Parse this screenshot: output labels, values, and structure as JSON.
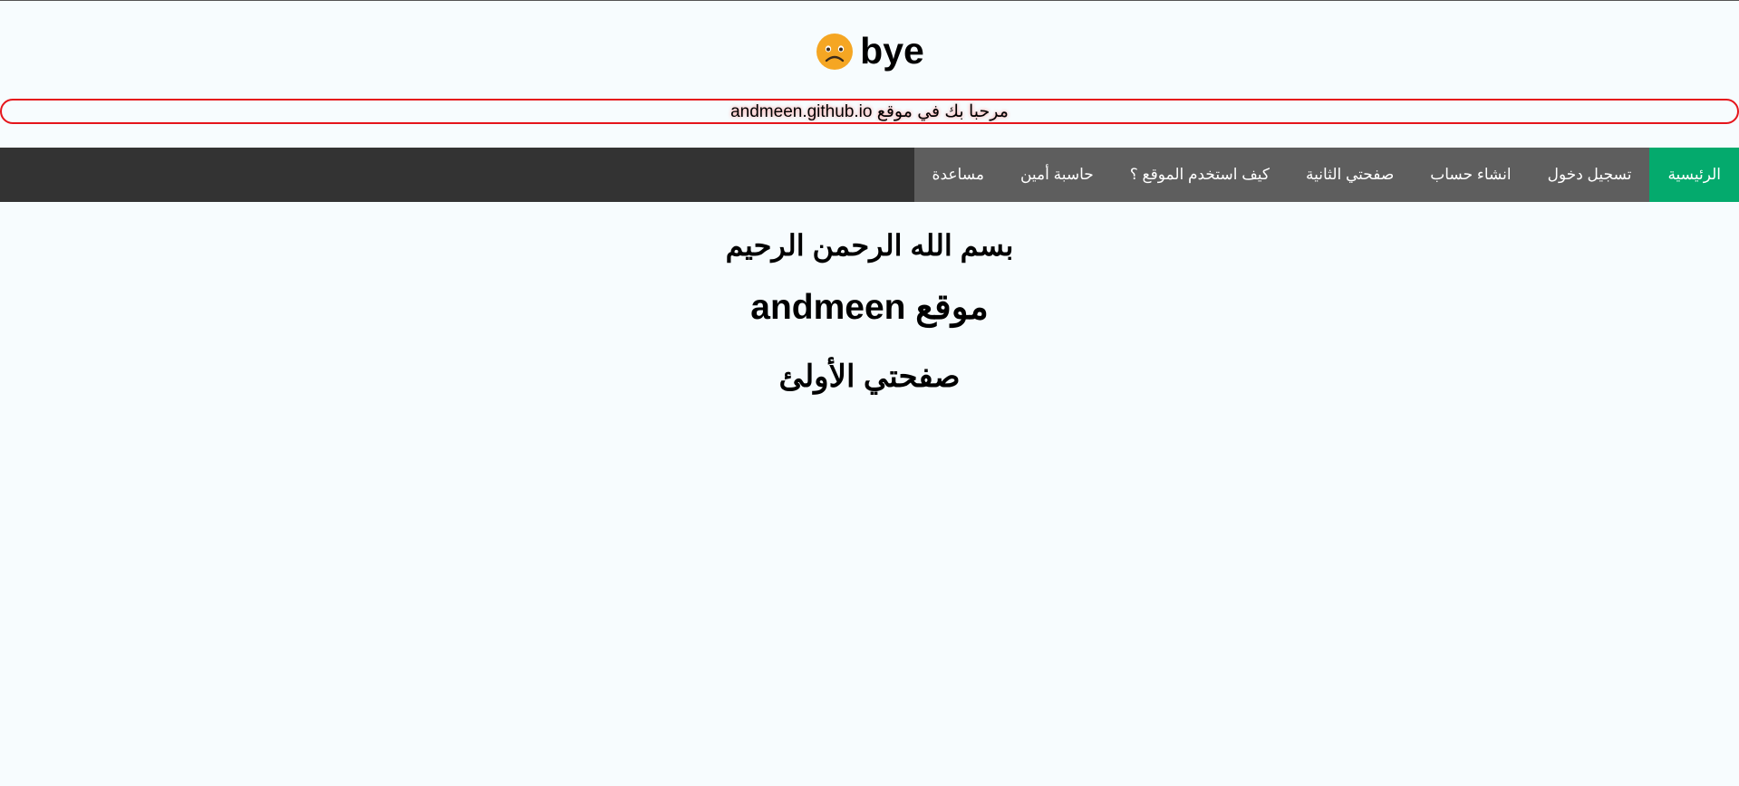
{
  "header": {
    "title": "bye",
    "icon": "worried-face-icon",
    "icon_color": "#f5a623"
  },
  "welcome": {
    "text": "مرحبا بك في موقع andmeen.github.io",
    "border_color": "#e5151b"
  },
  "nav": {
    "active_color": "#04aa6d",
    "items": [
      {
        "label": "الرئيسية"
      },
      {
        "label": "تسجيل دخول"
      },
      {
        "label": "انشاء حساب"
      },
      {
        "label": "صفحتي الثانية"
      },
      {
        "label": "كيف استخدم الموقع ؟"
      },
      {
        "label": "حاسبة أمين"
      },
      {
        "label": "مساعدة"
      }
    ]
  },
  "main": {
    "basmala": "بسم الله الرحمن الرحيم",
    "site_heading": "موقع andmeen",
    "page_heading": "صفحتي الأولئ"
  }
}
